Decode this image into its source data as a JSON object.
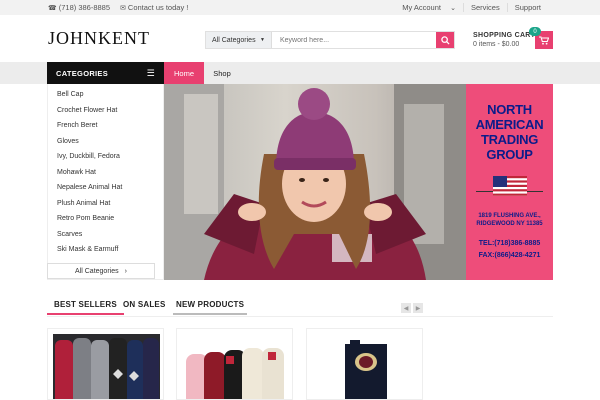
{
  "topbar": {
    "phone": "(718) 386-8885",
    "contact": "Contact us today !",
    "links": [
      "My Account",
      "Services",
      "Support"
    ]
  },
  "header": {
    "logo": "JOHNKENT",
    "search_category": "All Categories",
    "search_placeholder": "Keyword here...",
    "cart_title": "SHOPPING CART",
    "cart_summary": "0 items - $0.00",
    "cart_count": "0"
  },
  "nav": {
    "categories_label": "CATEGORIES",
    "home": "Home",
    "shop": "Shop"
  },
  "sidebar": {
    "items": [
      "Bell Cap",
      "Crochet Flower Hat",
      "French Beret",
      "Gloves",
      "Ivy, Duckbill, Fedora",
      "Mohawk Hat",
      "Nepalese Animal Hat",
      "Plush Animal Hat",
      "Retro Pom Beanie",
      "Scarves",
      "Ski Mask & Earmuff"
    ],
    "all_categories": "All Categories"
  },
  "promo": {
    "line1": "NORTH",
    "line2": "AMERICAN",
    "line3": "TRADING",
    "line4": "GROUP",
    "address1": "1819 FLUSHING AVE.,",
    "address2": "RIDGEWOOD NY 11385",
    "tel": "TEL:(718)386-8885",
    "fax": "FAX:(866)428-4271"
  },
  "tabs": [
    "BEST SELLERS",
    "ON SALES",
    "NEW PRODUCTS"
  ],
  "colors": {
    "accent": "#e84070",
    "dark": "#111111",
    "promo_bg": "#ee4d7a",
    "promo_text": "#0b1c8a",
    "badge": "#1ba58a"
  }
}
